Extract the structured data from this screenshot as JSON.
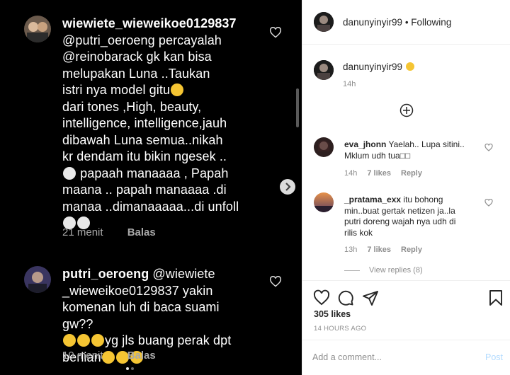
{
  "media": {
    "comments": [
      {
        "username": "wiewiete_wieweikoe0129837",
        "text_lines": [
          "@putri_oeroeng percayalah",
          "@reinobarack gk kan bisa",
          "melupakan Luna ..Taukan",
          "istri nya model gitu",
          "dari tones ,High, beauty,",
          "intelligence, intelligence,jauh",
          "dibawah Luna semua..nikah",
          "kr dendam itu bikin ngesek ..",
          " papaah manaaaa , Papah",
          "maana .. papah manaaaa .di",
          "manaa ..dimanaaaaa...di unfoll",
          ""
        ],
        "time": "21 menit",
        "reply_label": "Balas"
      },
      {
        "username": "putri_oeroeng",
        "text_lines": [
          " @wiewiete",
          "_wieweikoe0129837 yakin",
          "komenan luh di baca suami gw??",
          "yg jls buang perak dpt",
          "berlian"
        ],
        "time": "10 menit",
        "reply_label": "Balas"
      }
    ]
  },
  "side": {
    "header": {
      "username": "danunyinyir99",
      "separator": " • ",
      "follow_status": "Following"
    },
    "caption": {
      "username": "danunyinyir99",
      "time": "14h"
    },
    "comments": [
      {
        "username": "eva_jhonn",
        "text": "Yaelah.. Lupa sitini.. Mklum udh tua□□",
        "time": "14h",
        "likes": "7 likes",
        "reply": "Reply"
      },
      {
        "username": "_pratama_exx",
        "text": "itu bohong min..buat gertak netizen ja..la putri doreng wajah nya udh di rilis kok",
        "time": "13h",
        "likes": "7 likes",
        "reply": "Reply"
      }
    ],
    "view_replies": "View replies (8)",
    "likes": "305 likes",
    "ago": "14 HOURS AGO",
    "add_comment_placeholder": "Add a comment...",
    "post_label": "Post"
  },
  "icons": {
    "heart": "heart-icon",
    "comment": "comment-icon",
    "share": "paper-plane-icon",
    "save": "bookmark-icon",
    "plus": "plus-circle-icon",
    "next": "chevron-right-icon"
  },
  "colors": {
    "text": "#262626",
    "muted": "#8e8e8e",
    "link_disabled": "#b3dbff",
    "media_bg": "#000000"
  }
}
